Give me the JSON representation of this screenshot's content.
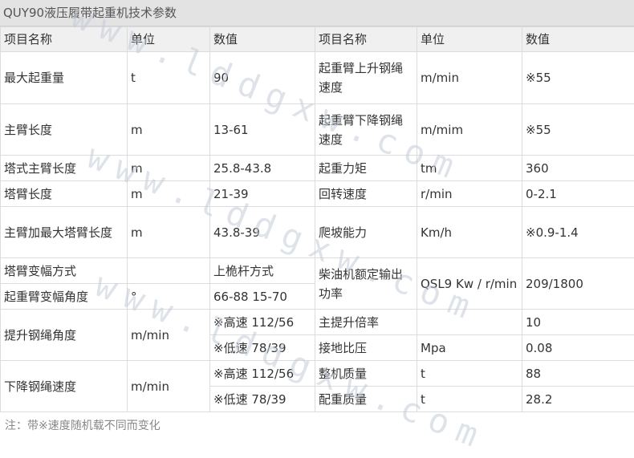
{
  "title": "QUY90液压履带起重机技术参数",
  "headers": [
    "项目名称",
    "单位",
    "数值",
    "项目名称",
    "单位",
    "数值"
  ],
  "left": [
    [
      "最大起重量",
      "t",
      "90"
    ],
    [
      "主臂长度",
      "m",
      "13-61"
    ],
    [
      "塔式主臂长度",
      "m",
      "25.8-43.8"
    ],
    [
      "塔臂长度",
      "m",
      "21-39"
    ],
    [
      "主臂加最大塔臂长度",
      "m",
      "43.8-39"
    ],
    [
      "塔臂变幅方式",
      "",
      "上桅杆方式"
    ],
    [
      "起重臂变幅角度",
      "°",
      "66-88 15-70"
    ],
    [
      "提升钢绳角度",
      "m/min",
      "※高速 112/56",
      "※低速 78/39"
    ],
    [
      "下降钢绳速度",
      "m/min",
      "※高速 112/56",
      "※低速 78/39"
    ]
  ],
  "right": [
    [
      "起重臂上升钢绳速度",
      "m/min",
      "※55"
    ],
    [
      "起重臂下降钢绳速度",
      "m/mim",
      "※55"
    ],
    [
      "起重力矩",
      "tm",
      "360"
    ],
    [
      "回转速度",
      "r/min",
      "0-2.1"
    ],
    [
      "爬坡能力",
      "Km/h",
      "※0.9-1.4"
    ],
    [
      "柴油机额定输出功率",
      "QSL9 Kw / r/min",
      "209/1800"
    ],
    [
      "主提升倍率",
      "",
      "10"
    ],
    [
      "接地比压",
      "Mpa",
      "0.08"
    ],
    [
      "整机质量",
      "t",
      "88"
    ],
    [
      "配重质量",
      "t",
      "28.2"
    ]
  ],
  "note": "注：带※速度随机载不同而变化",
  "watermark": "www.lddgxw.com"
}
